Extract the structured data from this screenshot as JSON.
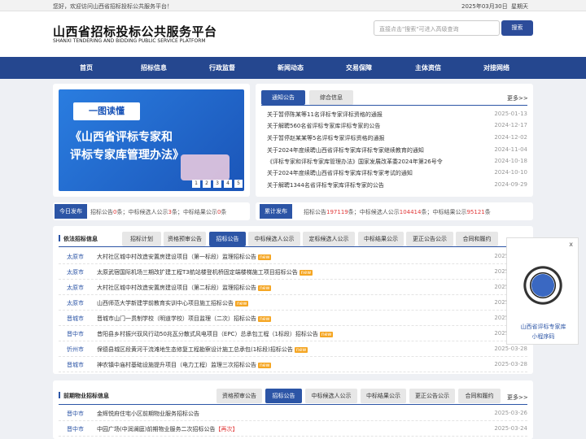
{
  "topbar": {
    "welcome": "您好，欢迎访问山西省招标投标公共服务平台！",
    "date": "2025年03月30日",
    "weekday": "星期天"
  },
  "header": {
    "title_cn": "山西省招标投标公共服务平台",
    "title_en": "SHANXI TENDERING AND BIDDING PUBLIC SERVICE PLATFORM",
    "search_placeholder": "直接点击\"搜索\"可进入高级查询",
    "search_button": "搜索"
  },
  "nav": [
    "首页",
    "招标信息",
    "行政监督",
    "新闻动态",
    "交易保障",
    "主体资信",
    "对接网络"
  ],
  "banner": {
    "tag": "一图读懂",
    "line1": "《山西省评标专家和",
    "line2": "评标专家库管理办法》",
    "pages": [
      "1",
      "2",
      "3",
      "4",
      "5"
    ]
  },
  "news": {
    "tabs": [
      "通知公告",
      "综合信息"
    ],
    "more": "更多>>",
    "items": [
      {
        "title": "关于暂停陈某等11名评标专家评标资格的通报",
        "date": "2025-01-13"
      },
      {
        "title": "关于解聘560名省评标专家库评标专家的公告",
        "date": "2024-12-17"
      },
      {
        "title": "关于暂停赵某某等5名评标专家评标资格的通报",
        "date": "2024-12-02"
      },
      {
        "title": "关于2024年度续聘山西省评标专家库评标专家继续教育的通知",
        "date": "2024-11-04"
      },
      {
        "title": "《评标专家和评标专家库管理办法》国家发展改革委2024年第26号令",
        "date": "2024-10-18"
      },
      {
        "title": "关于2024年度续聘山西省评标专家库评标专家考试的通知",
        "date": "2024-10-10"
      },
      {
        "title": "关于解聘1344名省评标专家库评标专家的公告",
        "date": "2024-09-29"
      }
    ]
  },
  "today": {
    "label": "今日发布",
    "a": "招标公告",
    "a_val": "0",
    "a_unit": "条；",
    "b": "中标候选人公示",
    "b_val": "3",
    "b_unit": "条；",
    "c": "中标结果公示",
    "c_val": "0",
    "c_unit": "条"
  },
  "total": {
    "label": "累计发布",
    "a": "招标公告",
    "a_val": "197119",
    "a_unit": "条；",
    "b": "中标候选人公示",
    "b_val": "104414",
    "b_unit": "条；",
    "c": "中标结果公示",
    "c_val": "95121",
    "c_unit": "条"
  },
  "sec1": {
    "title": "依法招标信息",
    "tabs": [
      "招标计划",
      "资格预审公告",
      "招标公告",
      "中标候选人公示",
      "定标候选人公示",
      "中标结果公示",
      "更正公告公示",
      "合同和履约"
    ],
    "rows": [
      {
        "city": "太原市",
        "title": "大村社区城中村改造安置房建设项目（第一标段）监理招标公告",
        "new": "new",
        "date": "2025-03-28"
      },
      {
        "city": "太原市",
        "title": "太原武宿国际机场三期改扩建工程T3航站楼登机桥固定端楼梯施工项目招标公告",
        "new": "new",
        "date": "2025-03-28"
      },
      {
        "city": "太原市",
        "title": "大村社区城中村改造安置房建设项目（第二标段）监理招标公告",
        "new": "new",
        "date": "2025-03-28"
      },
      {
        "city": "太原市",
        "title": "山西师范大学新建学前教育实训中心项目施工招标公告",
        "new": "new",
        "date": "2025-03-28"
      },
      {
        "city": "晋城市",
        "title": "晋城市山门一贯制学校（明道学校）项目监理（二次）招标公告",
        "new": "new",
        "date": "2025-03-28"
      },
      {
        "city": "晋中市",
        "title": "昔阳县乡村振兴驭风行动50兆瓦分散式风电项目（EPC）总承包工程（1标段）招标公告",
        "new": "new",
        "date": "2025-03-28"
      },
      {
        "city": "忻州市",
        "title": "保德县城区段黄河干流滩地生态修复工程勘察设计施工总承包(1标段)招标公告",
        "new": "new",
        "date": "2025-03-28"
      },
      {
        "city": "晋城市",
        "title": "神农镇中庙村基础设施提升项目（电力工程）监理三次招标公告",
        "new": "new",
        "date": "2025-03-28"
      }
    ]
  },
  "sec2": {
    "title": "前期物业招标信息",
    "tabs": [
      "资格预审公告",
      "招标公告",
      "中标候选人公示",
      "中标结果公示",
      "更正公告公示",
      "合同和履约"
    ],
    "more": "更多>>",
    "rows": [
      {
        "city": "晋中市",
        "title": "金辉悦府住宅小区前期物业服务招标公告",
        "date": "2025-03-26"
      },
      {
        "city": "晋中市",
        "title": "中园广场(中润澜庭)前期物业服务二次招标公告",
        "retag": "【再次】",
        "date": "2025-03-24"
      }
    ]
  },
  "popup": {
    "close": "x",
    "line1": "山西省评标专家库",
    "line2": "小程序码"
  }
}
